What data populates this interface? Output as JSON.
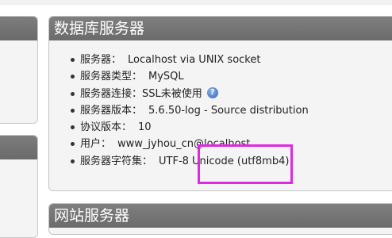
{
  "db_panel": {
    "title": "数据库服务器",
    "items": [
      {
        "label": "服务器：",
        "value": "Localhost via UNIX socket"
      },
      {
        "label": "服务器类型：",
        "value": "MySQL"
      },
      {
        "label": "服务器连接：",
        "value": "SSL未被使用"
      },
      {
        "label": "服务器版本：",
        "value": "5.6.50-log - Source distribution"
      },
      {
        "label": "协议版本：",
        "value": "10"
      },
      {
        "label": "用户：",
        "value": "www_jyhou_cn@localhost"
      },
      {
        "label": "服务器字符集：",
        "value": "UTF-8 Unicode (utf8mb4)"
      }
    ],
    "help_icon_glyph": "?"
  },
  "web_panel": {
    "title": "网站服务器"
  },
  "colors": {
    "panel_header": "#737373",
    "panel_body": "#f4f4f4",
    "highlight": "#e028e0",
    "help_icon": "#2f63b8"
  }
}
